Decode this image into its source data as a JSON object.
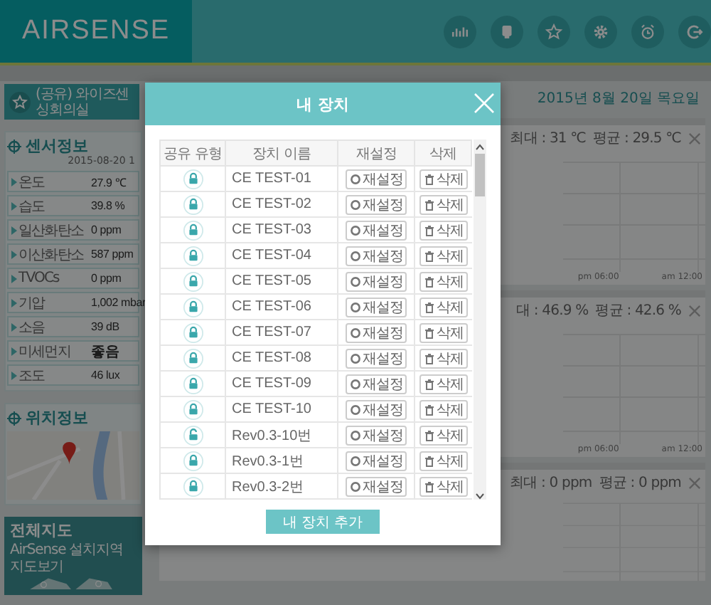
{
  "header": {
    "logo": "AIRSENSE"
  },
  "sidebar": {
    "favorite": {
      "title": "(공유) 와이즈센싱회의실"
    },
    "sensor_info": {
      "title": "센서정보",
      "timestamp": "2015-08-20 1",
      "rows": [
        {
          "label": "온도",
          "value": "27.9 ℃",
          "highlighted": false
        },
        {
          "label": "습도",
          "value": "39.8 %",
          "highlighted": false
        },
        {
          "label": "일산화탄소",
          "value": "0 ppm",
          "highlighted": false
        },
        {
          "label": "이산화탄소",
          "value": "587 ppm",
          "highlighted": false
        },
        {
          "label": "TVOCs",
          "value": "0 ppm",
          "highlighted": false
        },
        {
          "label": "기압",
          "value": "1,002 mbar",
          "highlighted": false
        },
        {
          "label": "소음",
          "value": "39 dB",
          "highlighted": false
        },
        {
          "label": "미세먼지",
          "value": "좋음",
          "highlighted": true
        },
        {
          "label": "조도",
          "value": "46 lux",
          "highlighted": false
        }
      ]
    },
    "location": {
      "title": "위치정보"
    },
    "overview_map": {
      "title": "전체지도",
      "subtitle": "AirSense 설치지역 지도보기"
    }
  },
  "main": {
    "date": "2015년 8월 20일 목요일",
    "charts": [
      {
        "max": "최대 : 31 ℃",
        "avg": "평균 : 29.5 ℃",
        "x_labels": [
          "pm 06:00",
          "am 12:00"
        ]
      },
      {
        "max": "대 : 46.9 %",
        "avg": "평균 : 42.6 %",
        "x_labels": [
          "pm 06:00",
          "am 12:00"
        ]
      },
      {
        "max": "최대 : 0 ppm",
        "avg": "평균 : 0 ppm"
      }
    ]
  },
  "modal": {
    "title": "내 장치",
    "columns": [
      "공유 유형",
      "장치 이름",
      "재설정",
      "삭제"
    ],
    "rows": [
      {
        "name": "CE TEST-01",
        "locked": true,
        "reset": "재설정",
        "delete": "삭제"
      },
      {
        "name": "CE TEST-02",
        "locked": true,
        "reset": "재설정",
        "delete": "삭제"
      },
      {
        "name": "CE TEST-03",
        "locked": true,
        "reset": "재설정",
        "delete": "삭제"
      },
      {
        "name": "CE TEST-04",
        "locked": true,
        "reset": "재설정",
        "delete": "삭제"
      },
      {
        "name": "CE TEST-05",
        "locked": true,
        "reset": "재설정",
        "delete": "삭제"
      },
      {
        "name": "CE TEST-06",
        "locked": true,
        "reset": "재설정",
        "delete": "삭제"
      },
      {
        "name": "CE TEST-07",
        "locked": true,
        "reset": "재설정",
        "delete": "삭제"
      },
      {
        "name": "CE TEST-08",
        "locked": true,
        "reset": "재설정",
        "delete": "삭제"
      },
      {
        "name": "CE TEST-09",
        "locked": true,
        "reset": "재설정",
        "delete": "삭제"
      },
      {
        "name": "CE TEST-10",
        "locked": true,
        "reset": "재설정",
        "delete": "삭제"
      },
      {
        "name": "Rev0.3-10번",
        "locked": false,
        "reset": "재설정",
        "delete": "삭제"
      },
      {
        "name": "Rev0.3-1번",
        "locked": true,
        "reset": "재설정",
        "delete": "삭제"
      },
      {
        "name": "Rev0.3-2번",
        "locked": true,
        "reset": "재설정",
        "delete": "삭제"
      }
    ],
    "add_button": "내 장치 추가"
  }
}
